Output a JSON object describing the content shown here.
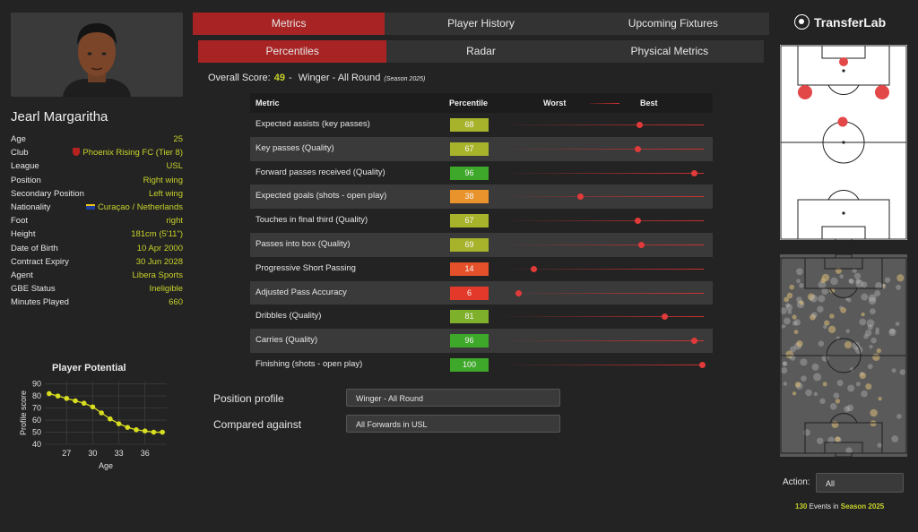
{
  "player": {
    "name": "Jearl Margaritha",
    "info": [
      {
        "label": "Age",
        "value": "25"
      },
      {
        "label": "Club",
        "value": "Phoenix Rising FC (Tier 8)",
        "icon": "club-shield-icon"
      },
      {
        "label": "League",
        "value": "USL"
      },
      {
        "label": "Position",
        "value": "Right wing"
      },
      {
        "label": "Secondary Position",
        "value": "Left wing"
      },
      {
        "label": "Nationality",
        "value": "Curaçao / Netherlands",
        "icon": "curacao-flag-icon"
      },
      {
        "label": "Foot",
        "value": "right"
      },
      {
        "label": "Height",
        "value": "181cm (5'11\")"
      },
      {
        "label": "Date of Birth",
        "value": "10 Apr 2000"
      },
      {
        "label": "Contract Expiry",
        "value": "30 Jun 2028"
      },
      {
        "label": "Agent",
        "value": "Libera Sports"
      },
      {
        "label": "GBE Status",
        "value": "Ineligible"
      },
      {
        "label": "Minutes Played",
        "value": "660"
      }
    ]
  },
  "tabs": {
    "primary": [
      "Metrics",
      "Player History",
      "Upcoming Fixtures"
    ],
    "primary_active": 0,
    "secondary": [
      "Percentiles",
      "Radar",
      "Physical Metrics"
    ],
    "secondary_active": 0
  },
  "overall": {
    "label": "Overall Score:",
    "score": "49",
    "sep": "-",
    "role": "Winger - All Round",
    "season": "(Season 2025)"
  },
  "table": {
    "headers": {
      "metric": "Metric",
      "percentile": "Percentile",
      "worst": "Worst",
      "best": "Best"
    },
    "rows": [
      {
        "metric": "Expected assists (key passes)",
        "percentile": 68,
        "color": "#a8b32c"
      },
      {
        "metric": "Key passes (Quality)",
        "percentile": 67,
        "color": "#a8b32c"
      },
      {
        "metric": "Forward passes received (Quality)",
        "percentile": 96,
        "color": "#3ea82a"
      },
      {
        "metric": "Expected goals (shots - open play)",
        "percentile": 38,
        "color": "#e8932b"
      },
      {
        "metric": "Touches in final third (Quality)",
        "percentile": 67,
        "color": "#a8b32c"
      },
      {
        "metric": "Passes into box (Quality)",
        "percentile": 69,
        "color": "#a8b32c"
      },
      {
        "metric": "Progressive Short Passing",
        "percentile": 14,
        "color": "#e3502a"
      },
      {
        "metric": "Adjusted Pass Accuracy",
        "percentile": 6,
        "color": "#e3392a"
      },
      {
        "metric": "Dribbles (Quality)",
        "percentile": 81,
        "color": "#7fb02b"
      },
      {
        "metric": "Carries (Quality)",
        "percentile": 96,
        "color": "#3ea82a"
      },
      {
        "metric": "Finishing (shots - open play)",
        "percentile": 100,
        "color": "#3ea82a"
      }
    ]
  },
  "profile": {
    "position_label": "Position profile",
    "position_value": "Winger - All Round",
    "compared_label": "Compared against",
    "compared_value": "All Forwards in USL"
  },
  "brand": {
    "name": "TransferLab"
  },
  "action": {
    "label": "Action:",
    "value": "All"
  },
  "events": {
    "count": "130",
    "text": "Events in",
    "season": "Season 2025"
  },
  "potential": {
    "title": "Player Potential",
    "ylabel": "Profile score",
    "xlabel": "Age"
  },
  "chart_data": {
    "type": "line",
    "title": "Player Potential",
    "xlabel": "Age",
    "ylabel": "Profile score",
    "x": [
      25,
      26,
      27,
      28,
      29,
      30,
      31,
      32,
      33,
      34,
      35,
      36,
      37,
      38
    ],
    "values": [
      82,
      80,
      78,
      76,
      74,
      71,
      66,
      61,
      57,
      54,
      52,
      51,
      50,
      50
    ],
    "xticks": [
      27,
      30,
      33,
      36
    ],
    "yticks": [
      40,
      50,
      60,
      70,
      80,
      90
    ],
    "xlim": [
      24.5,
      38.5
    ],
    "ylim": [
      40,
      92
    ],
    "grid": true,
    "color": "#d8de1f"
  }
}
